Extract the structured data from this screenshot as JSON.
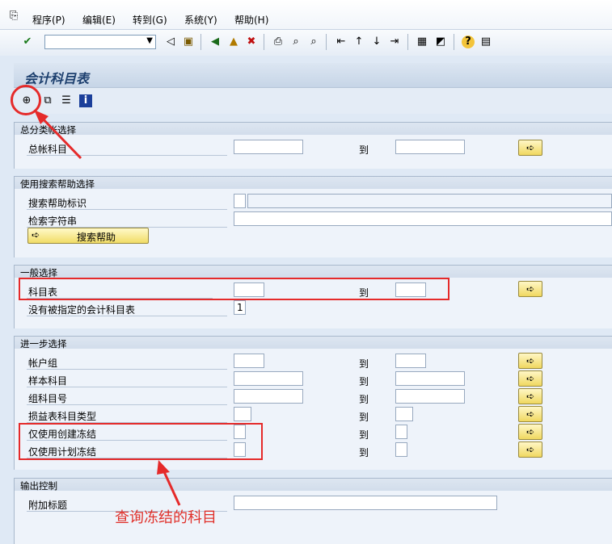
{
  "menubar": {
    "items": [
      "程序(P)",
      "编辑(E)",
      "转到(G)",
      "系统(Y)",
      "帮助(H)"
    ]
  },
  "toolbar": {
    "command_field": "",
    "icons": [
      "enter-icon",
      "back-icon",
      "save-icon",
      "back-nav-icon",
      "exit-icon",
      "cancel-icon",
      "print-icon",
      "find-icon",
      "find-next-icon",
      "first-page-icon",
      "prev-page-icon",
      "next-page-icon",
      "last-page-icon",
      "new-session-icon",
      "shortcut-icon",
      "help-icon",
      "layout-icon"
    ]
  },
  "page": {
    "title": "会计科目表"
  },
  "app_toolbar": {
    "icons": [
      "execute-icon",
      "variant-icon",
      "selection-options-icon",
      "info-icon"
    ]
  },
  "groups": {
    "gl_select": {
      "title": "总分类帐选择",
      "rows": [
        {
          "label": "总帐科目",
          "from": "",
          "to_label": "到",
          "to": ""
        }
      ]
    },
    "search_help": {
      "title": "使用搜索帮助选择",
      "rows": [
        {
          "label": "搜索帮助标识",
          "value": "",
          "desc": ""
        },
        {
          "label": "检索字符串",
          "value": ""
        }
      ],
      "button_label": "搜索帮助"
    },
    "general": {
      "title": "一般选择",
      "rows": [
        {
          "label": "科目表",
          "from": "",
          "to_label": "到",
          "to": ""
        },
        {
          "label": "没有被指定的会计科目表",
          "value": "1"
        }
      ]
    },
    "further": {
      "title": "进一步选择",
      "rows": [
        {
          "label": "帐户组",
          "from": "",
          "to_label": "到",
          "to": ""
        },
        {
          "label": "样本科目",
          "from": "",
          "to_label": "到",
          "to": ""
        },
        {
          "label": "组科目号",
          "from": "",
          "to_label": "到",
          "to": ""
        },
        {
          "label": "损益表科目类型",
          "from": "",
          "to_label": "到",
          "to": ""
        },
        {
          "label": "仅使用创建冻结",
          "from": "",
          "to_label": "到",
          "to": ""
        },
        {
          "label": "仅使用计划冻结",
          "from": "",
          "to_label": "到",
          "to": ""
        }
      ]
    },
    "output": {
      "title": "输出控制",
      "rows": [
        {
          "label": "附加标题",
          "value": ""
        }
      ]
    }
  },
  "annotation": {
    "text": "查询冻结的科目",
    "color": "#e0302a"
  }
}
